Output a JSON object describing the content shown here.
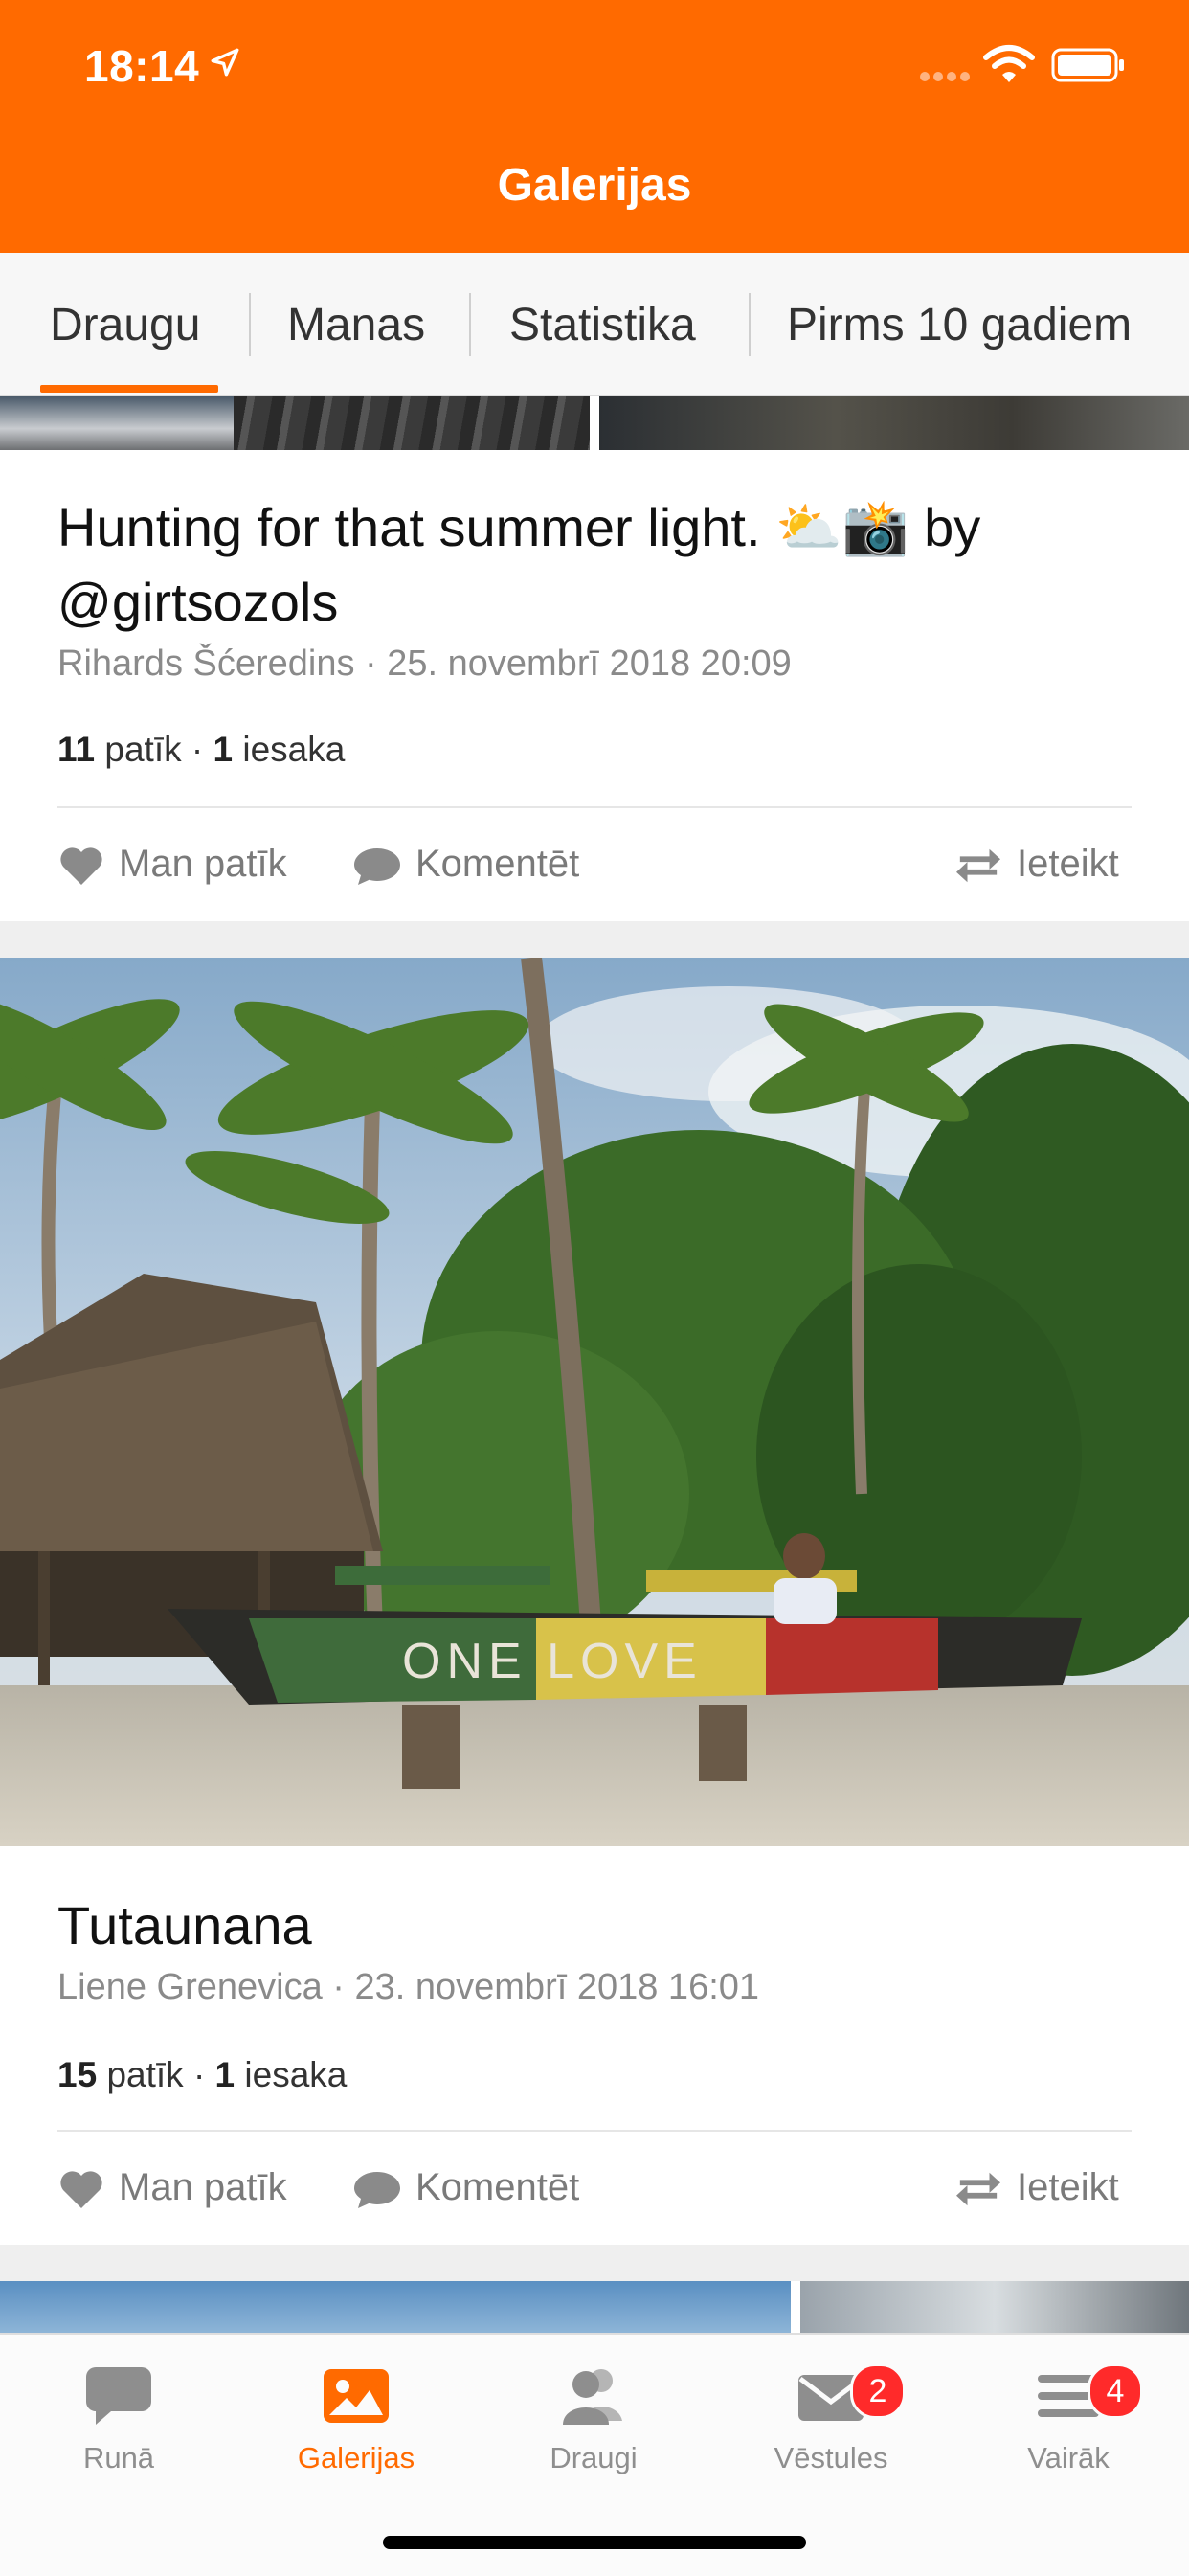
{
  "status_bar": {
    "time": "18:14"
  },
  "header": {
    "title": "Galerijas"
  },
  "tabs": [
    "Draugu",
    "Manas",
    "Statistika",
    "Pirms 10 gadiem"
  ],
  "posts": [
    {
      "title": "Hunting for that summer light. ⛅📸 by @girtsozols",
      "meta": "Rihards Šćeredins · 25. novembrī 2018 20:09",
      "likes": "11",
      "likes_label": "patīk",
      "recs": "1",
      "recs_label": "iesaka",
      "actions": {
        "like": "Man patīk",
        "comment": "Komentēt",
        "recommend": "Ieteikt"
      }
    },
    {
      "title": "Tutaunana",
      "meta": "Liene Grenevica · 23. novembrī 2018 16:01",
      "likes": "15",
      "likes_label": "patīk",
      "recs": "1",
      "recs_label": "iesaka",
      "photo_text": "ONE LOVE",
      "actions": {
        "like": "Man patīk",
        "comment": "Komentēt",
        "recommend": "Ieteikt"
      }
    }
  ],
  "bottom_nav": [
    {
      "label": "Runā",
      "icon": "chat-bubble-icon"
    },
    {
      "label": "Galerijas",
      "icon": "image-icon",
      "active": true
    },
    {
      "label": "Draugi",
      "icon": "friends-icon"
    },
    {
      "label": "Vēstules",
      "icon": "envelope-icon",
      "badge": "2"
    },
    {
      "label": "Vairāk",
      "icon": "menu-icon",
      "badge": "4"
    }
  ],
  "colors": {
    "accent": "#ff6a00",
    "badge": "#ff2a2a"
  }
}
